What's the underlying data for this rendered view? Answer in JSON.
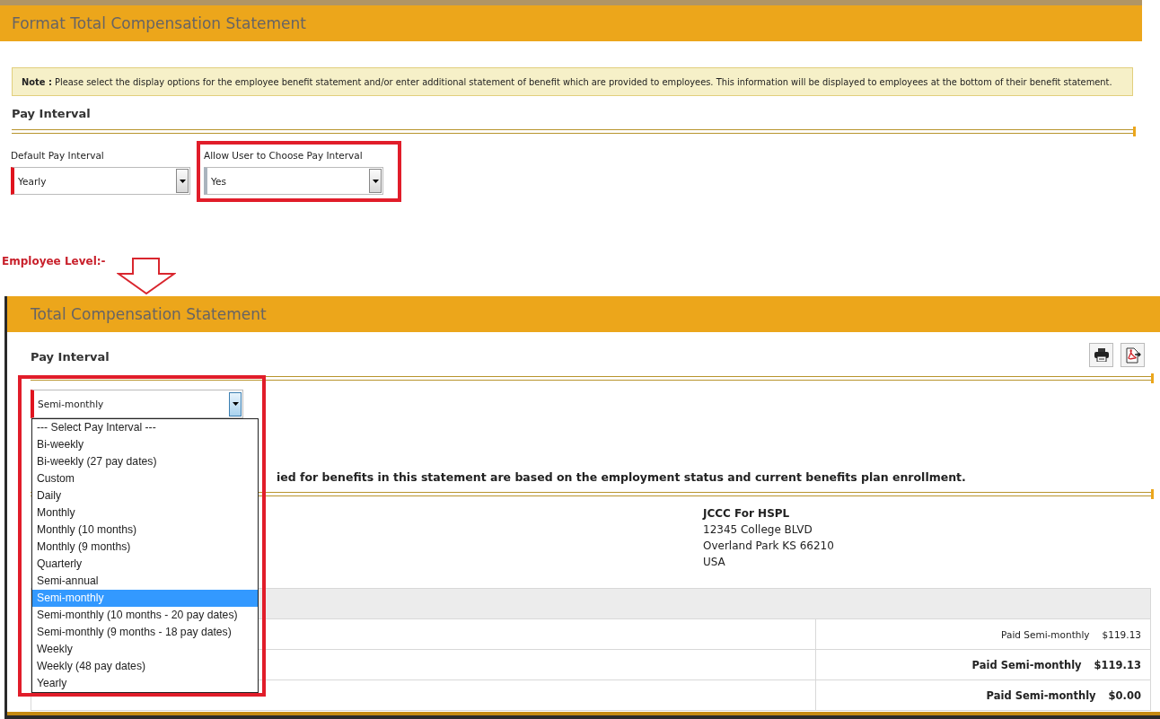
{
  "top_panel": {
    "title": "Format Total Compensation Statement",
    "note": {
      "label": "Note :",
      "text": "Please select the display options for the employee benefit statement and/or enter additional statement of benefit which are provided to employees. This information will be displayed to employees at the bottom of their benefit statement."
    },
    "section_title": "Pay Interval",
    "fields": [
      {
        "label": "Default Pay Interval",
        "value": "Yearly",
        "required": true,
        "highlighted": false
      },
      {
        "label": "Allow User to Choose Pay Interval",
        "value": "Yes",
        "required": false,
        "highlighted": true
      }
    ]
  },
  "annotation": {
    "label": "Employee Level:-"
  },
  "employee_panel": {
    "title": "Total Compensation Statement",
    "section_title": "Pay Interval",
    "pay_interval_select": {
      "value": "Semi-monthly",
      "required": true,
      "expanded": true,
      "highlighted": true,
      "options": [
        {
          "label": "--- Select Pay Interval ---",
          "selected": false
        },
        {
          "label": "Bi-weekly",
          "selected": false
        },
        {
          "label": "Bi-weekly (27 pay dates)",
          "selected": false
        },
        {
          "label": "Custom",
          "selected": false
        },
        {
          "label": "Daily",
          "selected": false
        },
        {
          "label": "Monthly",
          "selected": false
        },
        {
          "label": "Monthly (10 months)",
          "selected": false
        },
        {
          "label": "Monthly (9 months)",
          "selected": false
        },
        {
          "label": "Quarterly",
          "selected": false
        },
        {
          "label": "Semi-annual",
          "selected": false
        },
        {
          "label": "Semi-monthly",
          "selected": true
        },
        {
          "label": "Semi-monthly (10 months - 20 pay dates)",
          "selected": false
        },
        {
          "label": "Semi-monthly (9 months - 18 pay dates)",
          "selected": false
        },
        {
          "label": "Weekly",
          "selected": false
        },
        {
          "label": "Weekly (48 pay dates)",
          "selected": false
        },
        {
          "label": "Yearly",
          "selected": false
        }
      ]
    },
    "statement_note": "ied for benefits in this statement are based on the employment status and current benefits plan enrollment.",
    "employer": {
      "name": "JCCC For HSPL",
      "address": [
        "12345 College BLVD",
        "Overland Park KS 66210",
        "USA"
      ]
    },
    "table": {
      "rows": [
        {
          "interval": "Paid Semi-monthly",
          "amount": "$119.13",
          "bold": false
        },
        {
          "interval": "Paid Semi-monthly",
          "amount": "$119.13",
          "bold": true
        },
        {
          "interval": "Paid Semi-monthly",
          "amount": "$0.00",
          "bold": true
        }
      ]
    }
  }
}
